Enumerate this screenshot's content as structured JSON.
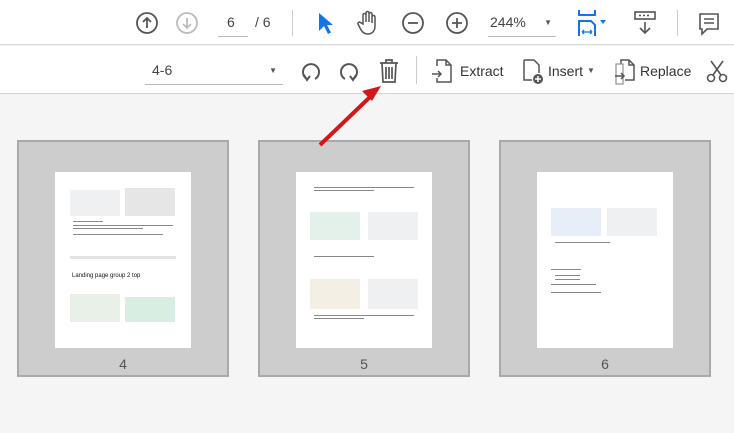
{
  "toolbar": {
    "current_page": "6",
    "total_pages": "/ 6",
    "zoom": "244%"
  },
  "organize": {
    "page_range": "4-6",
    "extract": "Extract",
    "insert": "Insert",
    "replace": "Replace"
  },
  "pages": [
    {
      "number": "4",
      "heading": "Landing page group 2 top"
    },
    {
      "number": "5"
    },
    {
      "number": "6"
    }
  ],
  "colors": {
    "accent": "#1473e6",
    "arrow": "#d0181b"
  }
}
